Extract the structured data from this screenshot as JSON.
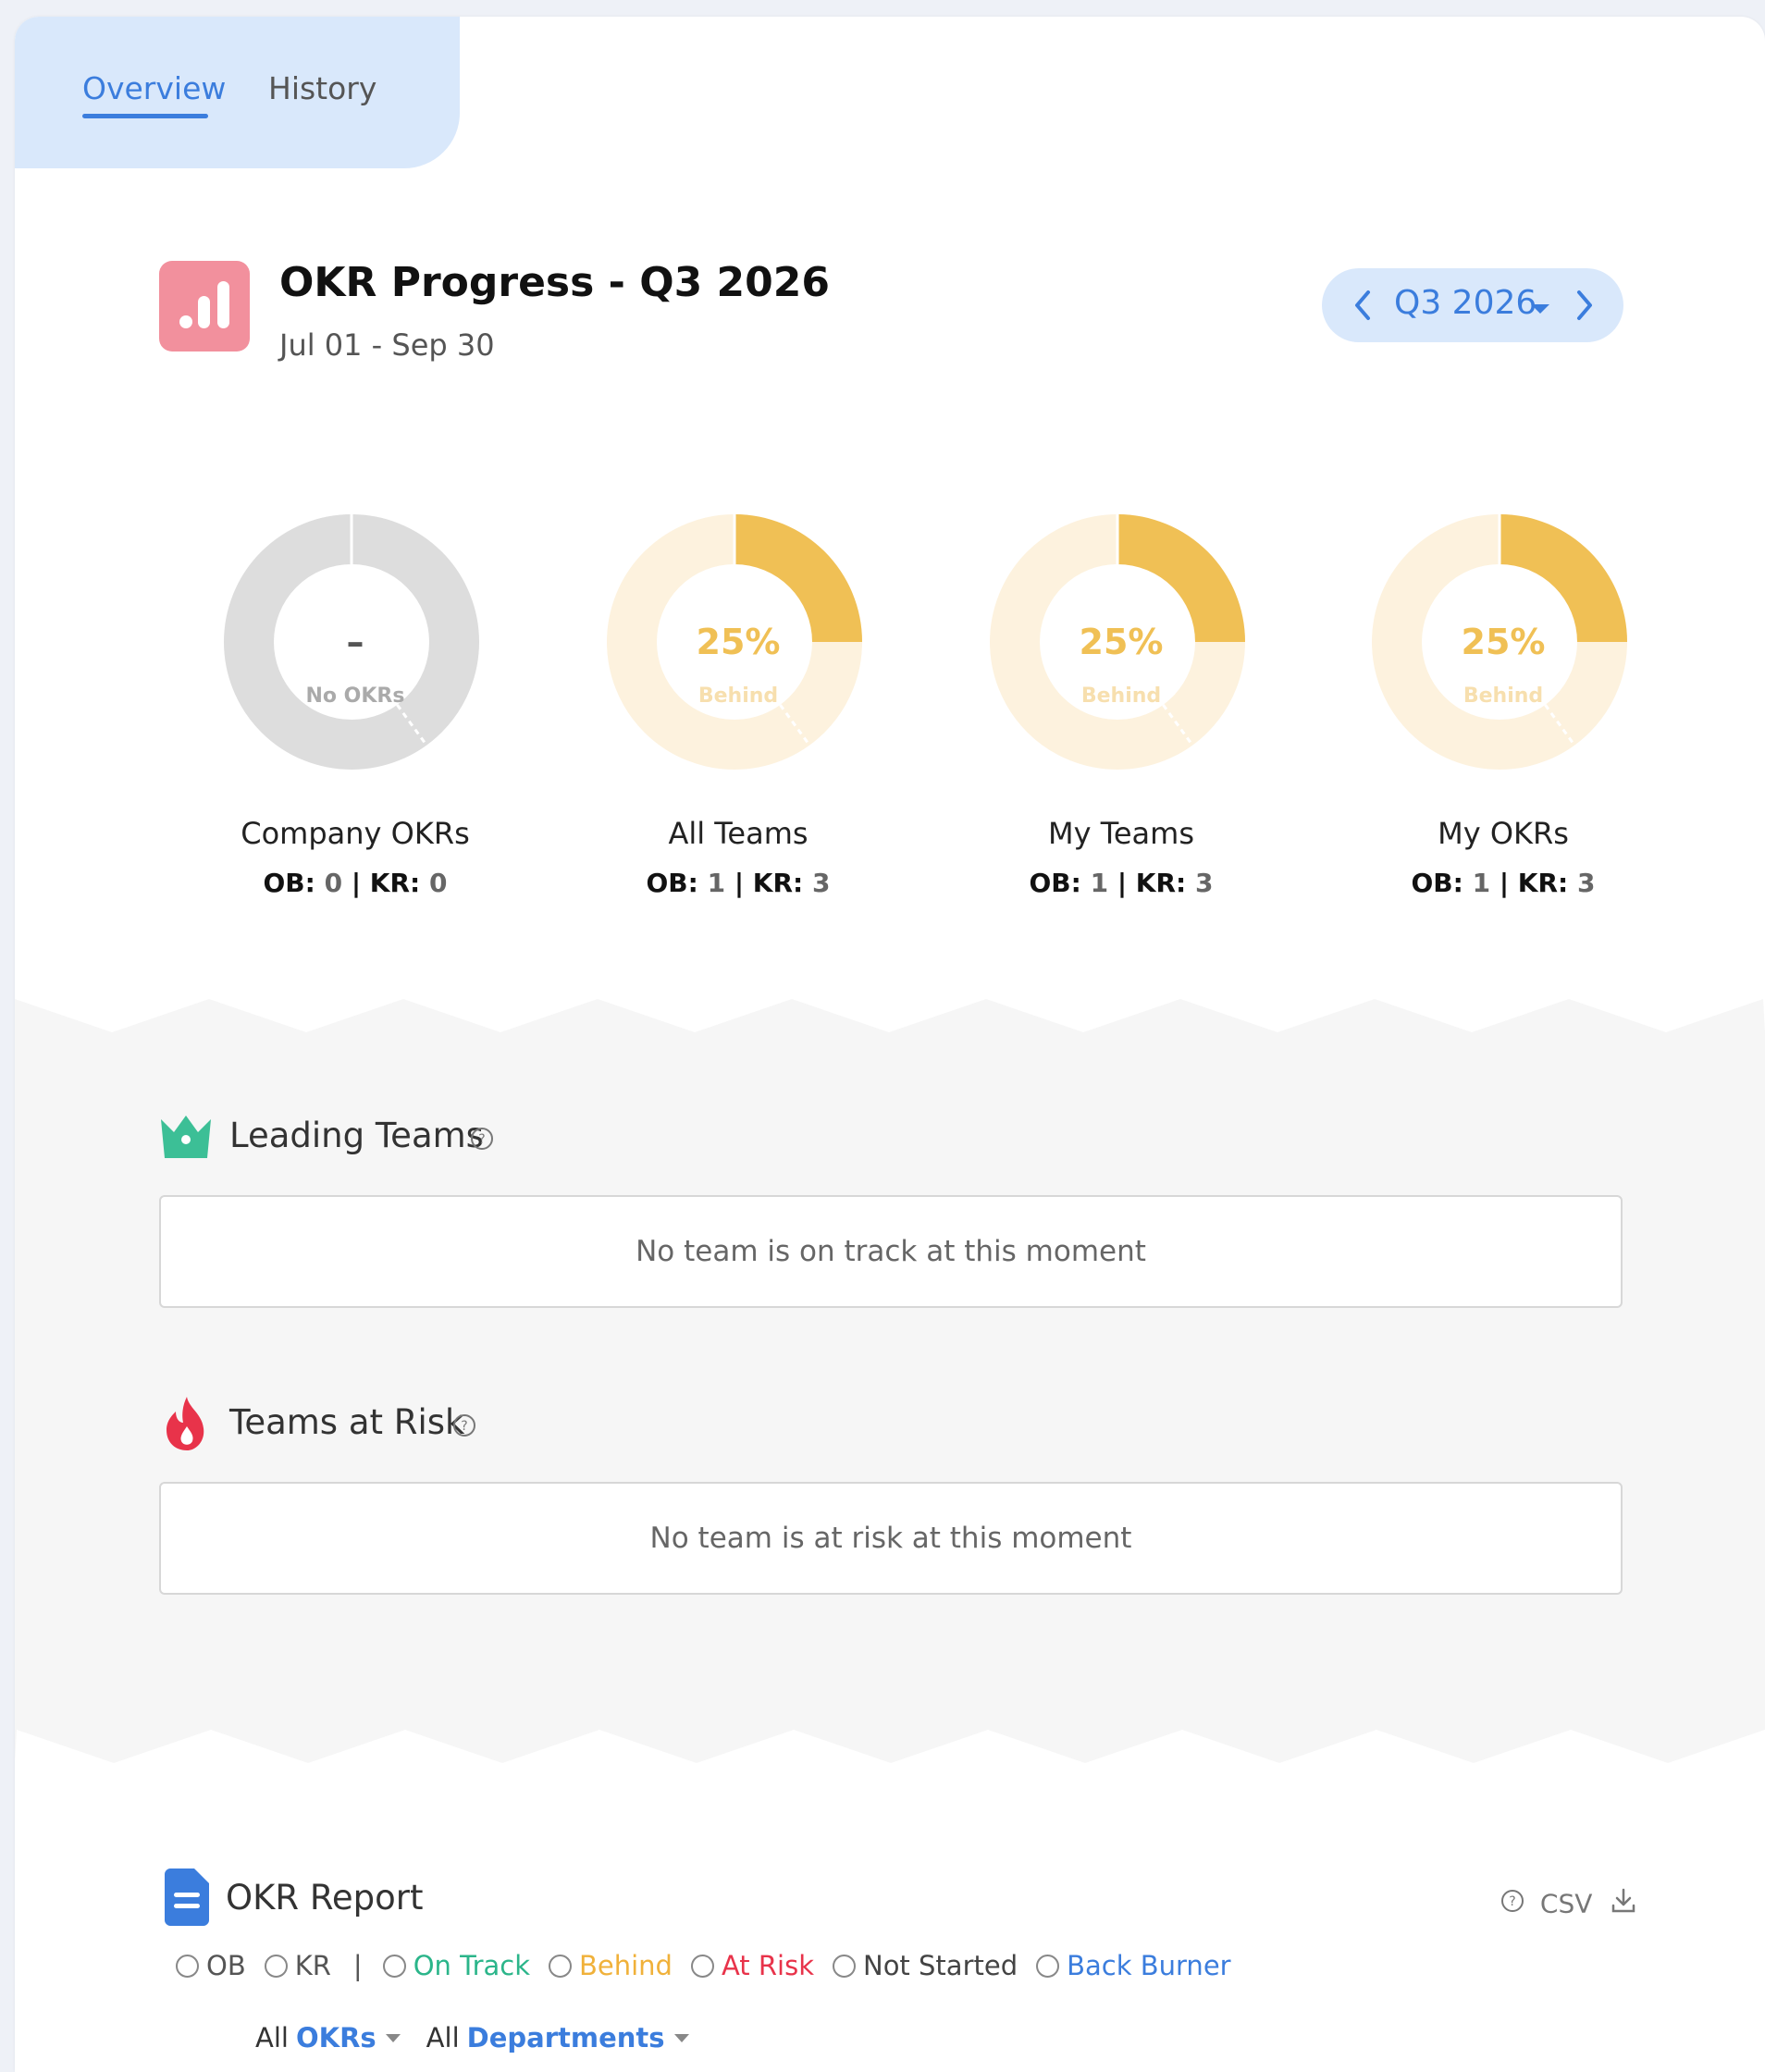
{
  "tabs": [
    {
      "label": "Overview",
      "active": true
    },
    {
      "label": "History",
      "active": false
    }
  ],
  "header": {
    "title": "OKR Progress - Q3 2026",
    "date_range": "Jul 01 - Sep 30",
    "icon": "bar-chart-icon",
    "quarter_selector": {
      "label": "Q3 2026",
      "prev_icon": "chevron-left-icon",
      "next_icon": "chevron-right-icon",
      "dropdown_icon": "caret-down-icon"
    }
  },
  "summaries": [
    {
      "label": "Company OKRs",
      "value": "–",
      "status": "No OKRs",
      "progress": 0,
      "ob_label": "OB:",
      "ob": "0",
      "kr_label": "KR:",
      "kr": "0",
      "sep": "|"
    },
    {
      "label": "All Teams",
      "value": "25%",
      "status": "Behind",
      "progress": 0.25,
      "ob_label": "OB:",
      "ob": "1",
      "kr_label": "KR:",
      "kr": "3",
      "sep": "|"
    },
    {
      "label": "My Teams",
      "value": "25%",
      "status": "Behind",
      "progress": 0.25,
      "ob_label": "OB:",
      "ob": "1",
      "kr_label": "KR:",
      "kr": "3",
      "sep": "|"
    },
    {
      "label": "My OKRs",
      "value": "25%",
      "status": "Behind",
      "progress": 0.25,
      "ob_label": "OB:",
      "ob": "1",
      "kr_label": "KR:",
      "kr": "3",
      "sep": "|"
    }
  ],
  "leading_teams": {
    "title": "Leading Teams",
    "icon": "crown-icon",
    "help_icon": "question-circle-icon",
    "empty_text": "No team is on track at this moment"
  },
  "teams_at_risk": {
    "title": "Teams at Risk",
    "icon": "fire-icon",
    "help_icon": "question-circle-icon",
    "empty_text": "No team is at risk at this moment"
  },
  "report": {
    "title": "OKR Report",
    "icon": "document-icon",
    "csv_label": "CSV",
    "csv_help_icon": "question-circle-icon",
    "csv_download_icon": "download-icon",
    "type_filters": [
      "OB",
      "KR"
    ],
    "separator": "|",
    "status_filters": [
      {
        "label": "On Track",
        "color": "#2bb58a"
      },
      {
        "label": "Behind",
        "color": "#f0b13a"
      },
      {
        "label": "At Risk",
        "color": "#e8334a"
      },
      {
        "label": "Not Started",
        "color": "#444444"
      },
      {
        "label": "Back Burner",
        "color": "#3b7ddd"
      }
    ],
    "dropdowns": [
      {
        "prefix": "All",
        "value": "OKRs"
      },
      {
        "prefix": "All",
        "value": "Departments"
      }
    ]
  },
  "colors": {
    "accent": "#3b7ddd",
    "behind": "#f0c055",
    "behind_light": "#fdf2de",
    "no_okr": "#dddddd",
    "logo": "#f2909d"
  }
}
